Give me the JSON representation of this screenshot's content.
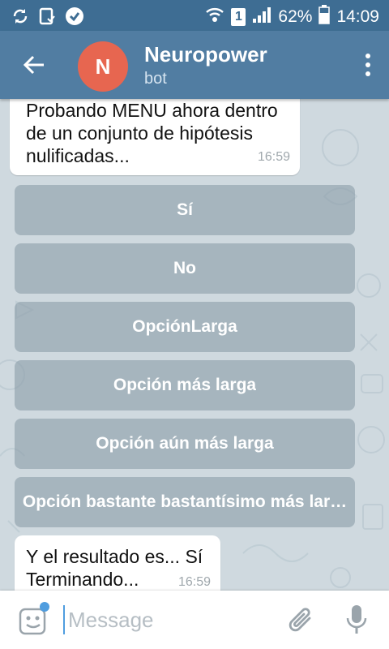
{
  "status_bar": {
    "battery_percent": "62%",
    "time": "14:09",
    "sim_slot": "1",
    "icons": [
      "sync-icon",
      "clipboard-icon",
      "check-badge-icon",
      "wifi-icon",
      "sim-icon",
      "signal-icon",
      "battery-icon"
    ]
  },
  "header": {
    "avatar_letter": "N",
    "title": "Neuropower",
    "subtitle": "bot",
    "colors": {
      "bar": "#517da2",
      "avatar": "#e76650"
    }
  },
  "messages": [
    {
      "text": "Probando MENU ahora dentro de un conjunto de hipótesis nulificadas...",
      "time": "16:59"
    },
    {
      "text": "Y el resultado es... Sí Terminando...",
      "time": "16:59"
    }
  ],
  "keyboard_buttons": [
    "Sí",
    "No",
    "OpciónLarga",
    "Opción más larga",
    "Opción aún más larga",
    "Opción bastante bastantísimo más lar…"
  ],
  "input_bar": {
    "placeholder": "Message",
    "icons": [
      "sticker-icon",
      "attach-icon",
      "mic-icon"
    ]
  }
}
